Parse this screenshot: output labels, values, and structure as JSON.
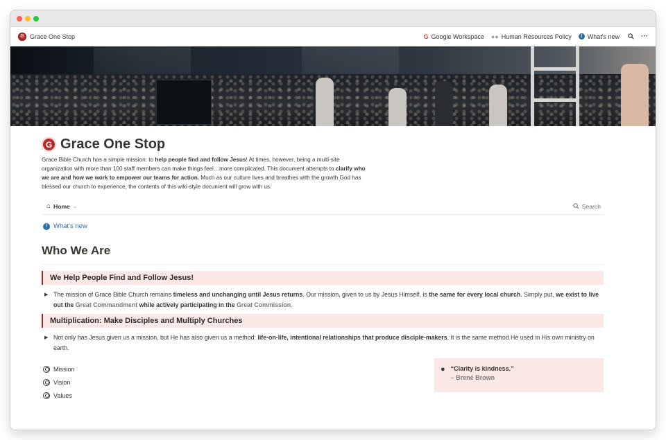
{
  "window": {
    "traffic_lights": [
      "close",
      "minimize",
      "zoom"
    ]
  },
  "topbar": {
    "site_name": "Grace One Stop",
    "logo_letter": "G",
    "links": [
      {
        "icon": "google-icon",
        "label": "Google Workspace"
      },
      {
        "icon": "people-icon",
        "label": "Human Resources Policy"
      },
      {
        "icon": "info-icon",
        "label": "What's new"
      }
    ]
  },
  "page": {
    "title": "Grace One Stop",
    "intro": {
      "p1": "Grace Bible Church has a simple mission: to ",
      "b1": "help people find and follow Jesus",
      "p2": "! At times, however, being a multi-site organization with more than 100 staff members can make things feel…more complicated. This document attempts to ",
      "b2": "clarify who we are and how we work to empower our teams for action.",
      "p3": " Much as our culture lives and breathes with the growth God has blessed our church to experience, the contents of this wiki-style document will grow with us."
    },
    "nav": {
      "home_label": "Home",
      "search_label": "Search"
    },
    "whats_new": "What's new",
    "section_heading": "Who We Are",
    "callout1": "We Help People Find and Follow Jesus!",
    "toggle1": {
      "t1": "The mission of Grace Bible Church remains ",
      "b1": "timeless and unchanging until Jesus returns",
      "t2": ". Our mission, given to us by Jesus Himself, is ",
      "b2": "the same for every local church",
      "t3": ". Simply put, ",
      "b3": "we exist to live out the ",
      "l1": "Great Commandment",
      "b4": " while actively participating in the ",
      "l2": "Great Commission",
      "t4": "."
    },
    "callout2": "Multiplication: Make Disciples and Multiply Churches",
    "toggle2": {
      "t1": "Not only has Jesus given us a mission, but He has also given us a method: ",
      "b1": "life-on-life, intentional relationships that produce disciple-makers",
      "t2": ". It is the same method He used in His own ministry on earth."
    },
    "list": [
      "Mission",
      "Vision",
      "Values"
    ],
    "quote": {
      "text": "“Clarity is kindness.”",
      "author": "– Brené Brown"
    }
  }
}
